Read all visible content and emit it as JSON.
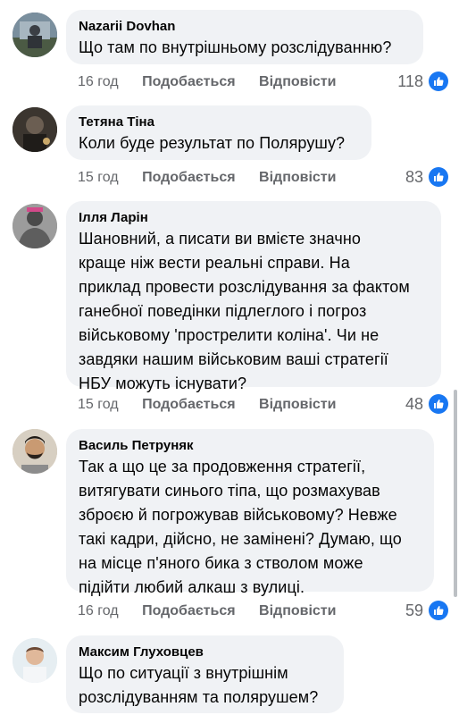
{
  "comments": [
    {
      "author": "Nazarii Dovhan",
      "text": "Що там по внутрішньому розслідуванню?",
      "time": "16 год",
      "like_action": "Подобається",
      "reply_action": "Відповісти",
      "likes": "118"
    },
    {
      "author": "Тетяна Тіна",
      "text": "Коли буде результат по Полярушу?",
      "time": "15 год",
      "like_action": "Подобається",
      "reply_action": "Відповісти",
      "likes": "83"
    },
    {
      "author": "Ілля Ларін",
      "text_lines": [
        "Шановний, а писати ви вмієте значно",
        "краще ніж вести реальні справи. На",
        "приклад провести розслідування за фактом",
        "ганебної поведінки підлеглого і погроз",
        "військовому 'прострелити коліна'. Чи не",
        "завдяки нашим військовим ваші стратегії",
        "НБУ можуть існувати?"
      ],
      "time": "15 год",
      "like_action": "Подобається",
      "reply_action": "Відповісти",
      "likes": "48"
    },
    {
      "author": "Василь Петруняк",
      "text_lines": [
        "Так а що це за продовження стратегії,",
        "витягувати синього тіпа, що розмахував",
        "зброєю й погрожував військовому? Невже",
        "такі кадри, дійсно, не замінені? Думаю, що",
        "на місце п'яного бика з стволом може",
        "підійти любий алкаш з вулиці."
      ],
      "time": "16 год",
      "like_action": "Подобається",
      "reply_action": "Відповісти",
      "likes": "59"
    },
    {
      "author": "Максим Глуховцев",
      "text_lines": [
        "Що по ситуації з внутрішнім",
        "розслідуванням та полярушем?"
      ]
    }
  ],
  "colors": {
    "bubble_bg": "#f0f2f5",
    "meta_text": "#65676b",
    "like_blue": "#1877f2"
  },
  "icons": {
    "like": "thumbs-up-icon"
  }
}
